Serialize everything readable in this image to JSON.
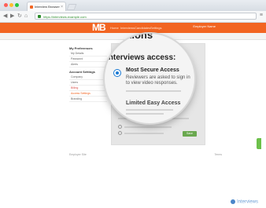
{
  "browser": {
    "tab_title": "Interview Browser",
    "url": "https://interviews.example.com"
  },
  "site": {
    "logo": "MB",
    "nav": [
      "Home",
      "Interviews",
      "Candidates",
      "Settings"
    ],
    "user": "Employer Name"
  },
  "sidebar": {
    "sections": [
      {
        "heading": "My Preferences",
        "items": [
          "My Details",
          "Password",
          "Alerts"
        ]
      },
      {
        "heading": "Account Settings",
        "items": [
          "Company",
          "Users",
          "Billing",
          "Access Settings",
          "Branding"
        ]
      }
    ],
    "active_item": "Access Settings"
  },
  "main": {
    "title": "Options",
    "heading": "Interviews access:",
    "options": [
      {
        "title": "Most Secure Access",
        "description": "Reviewers are asked to sign in to view video responses.",
        "selected": true
      },
      {
        "title": "Limited Easy Access",
        "description": "",
        "selected": false
      }
    ],
    "ok_label": "Save"
  },
  "footer": {
    "left": "Employer Site",
    "right": "Terms"
  },
  "watermark": "Interviews"
}
